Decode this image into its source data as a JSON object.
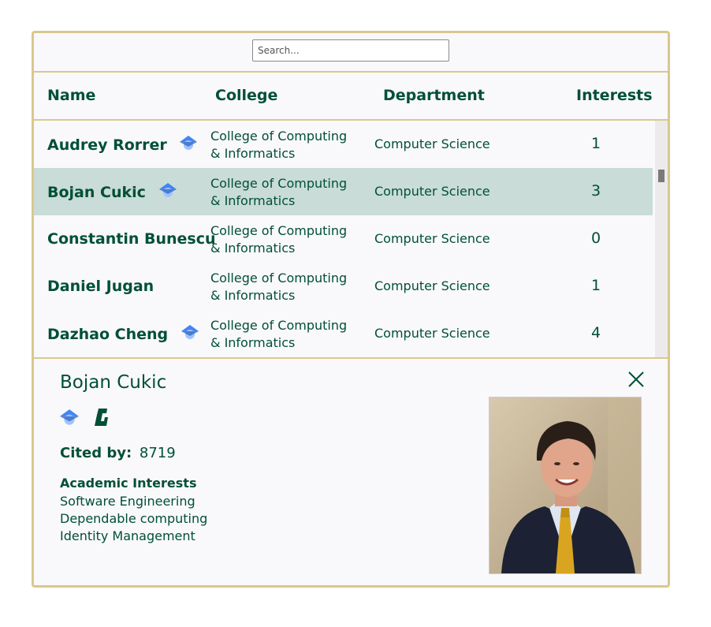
{
  "search": {
    "placeholder": "Search..."
  },
  "columns": {
    "name": "Name",
    "college": "College",
    "department": "Department",
    "interests": "Interests"
  },
  "rows": [
    {
      "name": "Audrey Rorrer",
      "scholar": true,
      "college": "College of Computing & Informatics",
      "department": "Computer Science",
      "interests": "1",
      "selected": false
    },
    {
      "name": "Bojan Cukic",
      "scholar": true,
      "college": "College of Computing & Informatics",
      "department": "Computer Science",
      "interests": "3",
      "selected": true
    },
    {
      "name": "Constantin Bunescu",
      "scholar": false,
      "college": "College of Computing & Informatics",
      "department": "Computer Science",
      "interests": "0",
      "selected": false
    },
    {
      "name": "Daniel Jugan",
      "scholar": false,
      "college": "College of Computing & Informatics",
      "department": "Computer Science",
      "interests": "1",
      "selected": false
    },
    {
      "name": "Dazhao Cheng",
      "scholar": true,
      "college": "College of Computing & Informatics",
      "department": "Computer Science",
      "interests": "4",
      "selected": false
    }
  ],
  "detail": {
    "name": "Bojan Cukic",
    "cited_label": "Cited by:",
    "cited_value": "8719",
    "interests_heading": "Academic Interests",
    "interests": [
      "Software Engineering",
      "Dependable computing",
      "Identity Management"
    ],
    "icons": [
      "google-scholar-icon",
      "unc-charlotte-logo-icon"
    ]
  },
  "colors": {
    "brand_green": "#005035",
    "gold_border": "#d9c88e",
    "selected_row": "#c9dcd7",
    "scholar_blue": "#4285f4"
  }
}
